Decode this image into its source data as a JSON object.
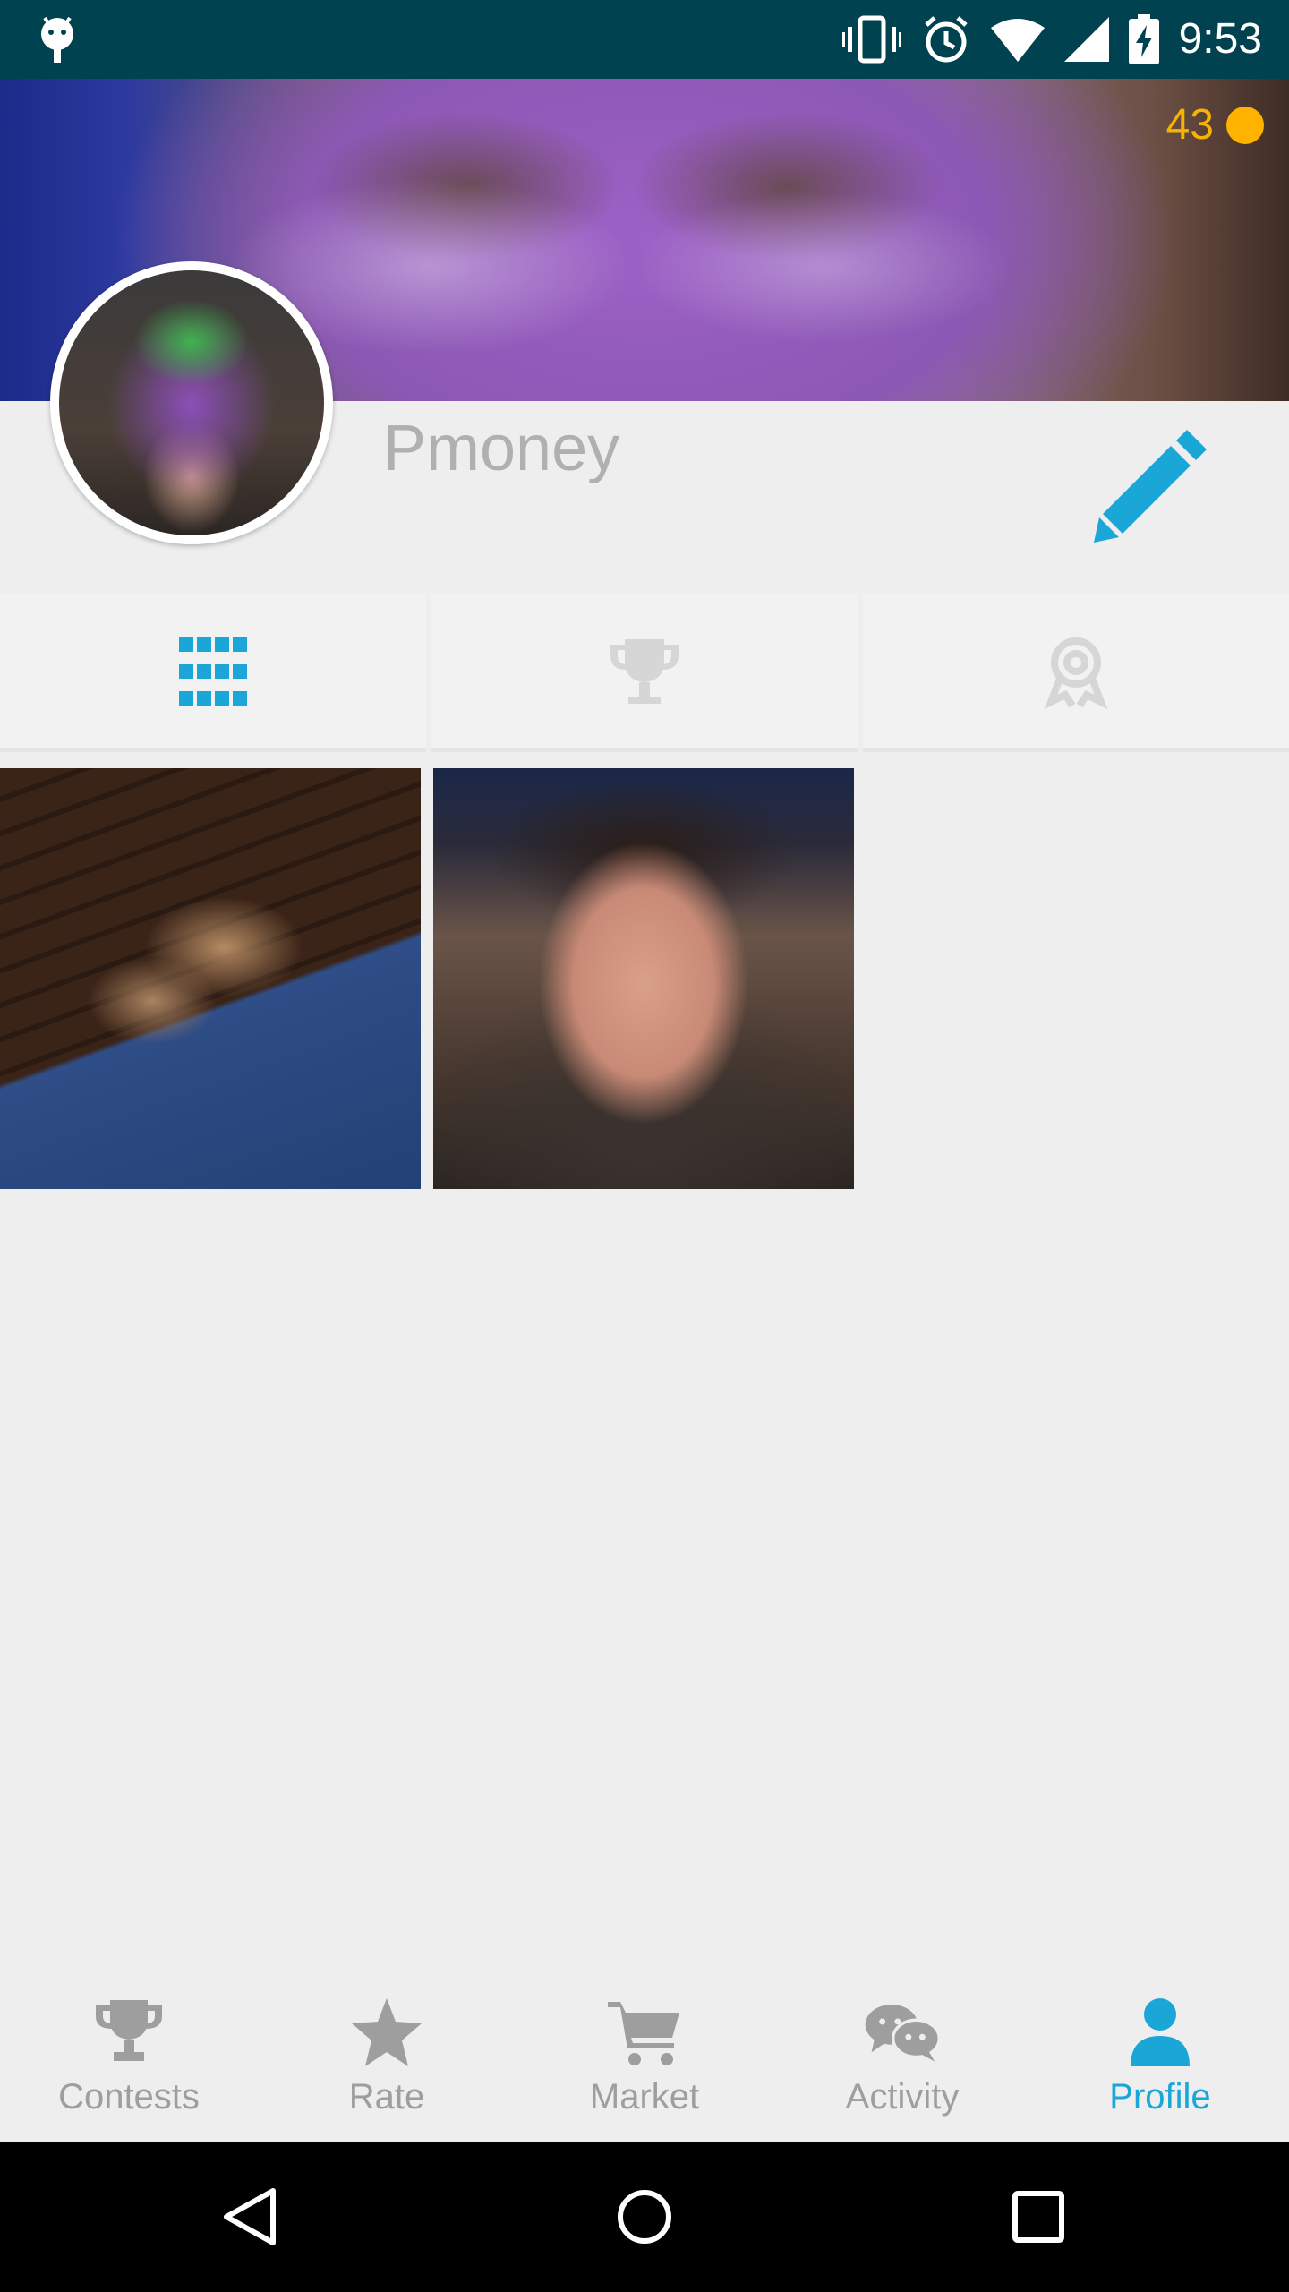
{
  "status_bar": {
    "time": "9:53",
    "icons": [
      "android-icon",
      "vibrate-icon",
      "alarm-icon",
      "wifi-icon",
      "signal-icon",
      "battery-charging-icon"
    ]
  },
  "header": {
    "coins": "43",
    "username": "Pmoney"
  },
  "tabs": [
    {
      "name": "grid-icon",
      "active": true
    },
    {
      "name": "trophy-icon",
      "active": false
    },
    {
      "name": "award-icon",
      "active": false
    }
  ],
  "bottom_nav": {
    "items": [
      {
        "label": "Contests",
        "icon": "trophy-icon",
        "active": false
      },
      {
        "label": "Rate",
        "icon": "star-icon",
        "active": false
      },
      {
        "label": "Market",
        "icon": "cart-icon",
        "active": false
      },
      {
        "label": "Activity",
        "icon": "chat-icon",
        "active": false
      },
      {
        "label": "Profile",
        "icon": "person-icon",
        "active": true
      }
    ]
  },
  "colors": {
    "status_bar": "#00424f",
    "accent": "#1aa7d8",
    "coin": "#ffb300",
    "inactive": "#9e9e9e",
    "background": "#eeeeee"
  }
}
